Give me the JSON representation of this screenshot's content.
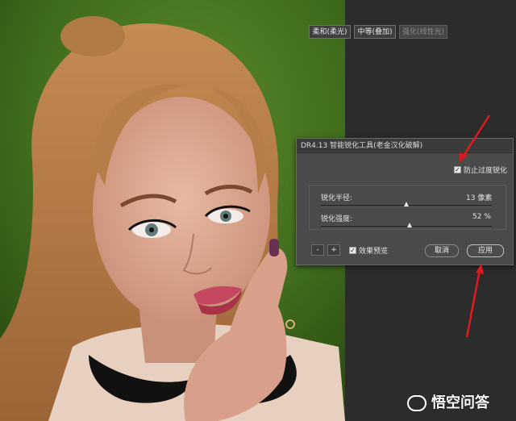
{
  "dialog": {
    "title": "DR4.13 智能锐化工具(老金汉化破解)",
    "modes": [
      "柔和(柔光)",
      "中等(叠加)",
      "强化(线性光)"
    ],
    "prevent_oversharpen_label": "防止过度锐化",
    "prevent_oversharpen_checked": true,
    "radius": {
      "label": "锐化半径:",
      "value": "13",
      "unit": "像素",
      "level": 0.5
    },
    "strength": {
      "label": "锐化强度:",
      "value": "52",
      "unit": "%",
      "level": 0.52
    },
    "minus_label": "-",
    "plus_label": "+",
    "preview_label": "效果预览",
    "preview_checked": true,
    "cancel_label": "取消",
    "apply_label": "应用"
  },
  "watermark": {
    "text": "悟空问答"
  },
  "colors": {
    "arrow": "#e0191e",
    "dialog_bg": "#4a4a4a",
    "canvas_bg": "#2c2c2c"
  }
}
